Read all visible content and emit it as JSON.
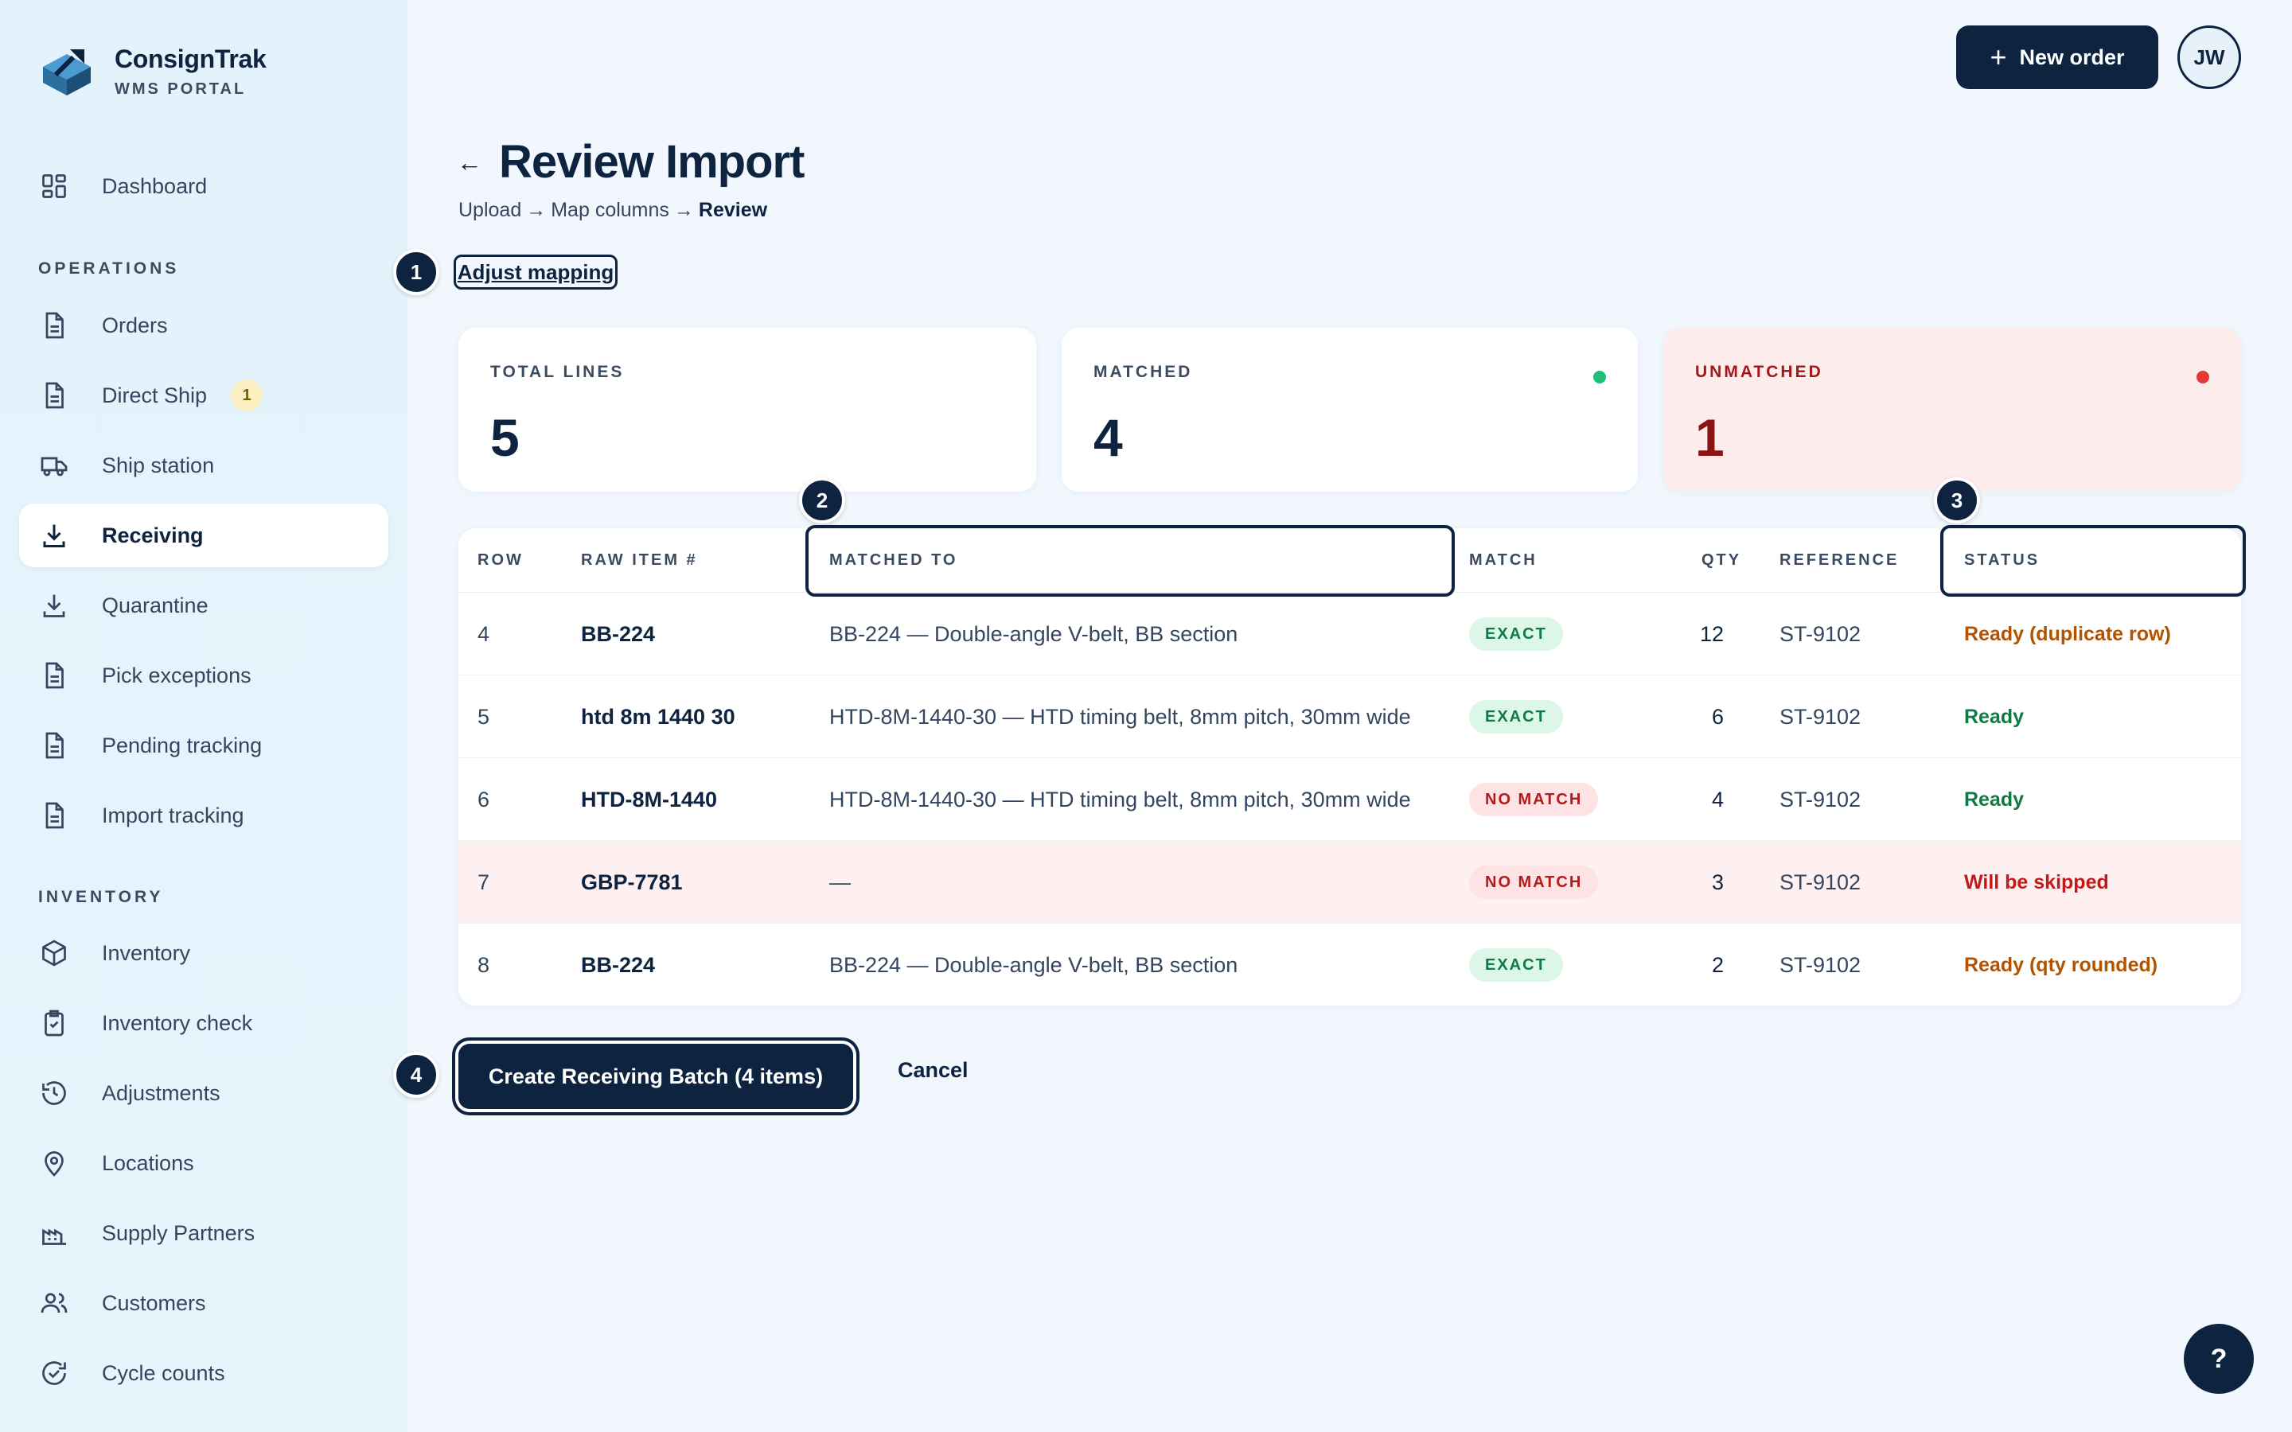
{
  "brand": {
    "name": "ConsignTrak",
    "subtitle": "WMS PORTAL"
  },
  "sidebar": {
    "top": [
      {
        "label": "Dashboard",
        "icon": "grid-icon"
      }
    ],
    "operations_label": "OPERATIONS",
    "operations": [
      {
        "label": "Orders",
        "icon": "document-icon"
      },
      {
        "label": "Direct Ship",
        "icon": "document-icon",
        "badge": "1"
      },
      {
        "label": "Ship station",
        "icon": "truck-icon"
      },
      {
        "label": "Receiving",
        "icon": "download-icon",
        "active": true
      },
      {
        "label": "Quarantine",
        "icon": "download-icon"
      },
      {
        "label": "Pick exceptions",
        "icon": "document-icon"
      },
      {
        "label": "Pending tracking",
        "icon": "document-icon"
      },
      {
        "label": "Import tracking",
        "icon": "document-icon"
      }
    ],
    "inventory_label": "INVENTORY",
    "inventory": [
      {
        "label": "Inventory",
        "icon": "box-icon"
      },
      {
        "label": "Inventory check",
        "icon": "clipboard-check-icon"
      },
      {
        "label": "Adjustments",
        "icon": "history-icon"
      },
      {
        "label": "Locations",
        "icon": "map-pin-icon"
      },
      {
        "label": "Supply Partners",
        "icon": "factory-icon"
      },
      {
        "label": "Customers",
        "icon": "users-icon"
      },
      {
        "label": "Cycle counts",
        "icon": "refresh-check-icon"
      }
    ]
  },
  "topbar": {
    "new_order": "New order",
    "avatar": "JW"
  },
  "header": {
    "title": "Review Import",
    "breadcrumb": {
      "step1": "Upload",
      "sep": "→",
      "step2": "Map columns",
      "step3": "Review"
    },
    "adjust_mapping": "Adjust mapping"
  },
  "steps": [
    "1",
    "2",
    "3",
    "4"
  ],
  "stats": {
    "total": {
      "label": "TOTAL LINES",
      "value": "5"
    },
    "matched": {
      "label": "MATCHED",
      "value": "4",
      "color": "#1fbf75"
    },
    "unmatched": {
      "label": "UNMATCHED",
      "value": "1",
      "color": "#e53935"
    }
  },
  "table": {
    "headers": {
      "row": "ROW",
      "raw": "RAW ITEM #",
      "matched": "MATCHED TO",
      "match": "MATCH",
      "qty": "QTY",
      "reference": "REFERENCE",
      "status": "STATUS"
    },
    "rows": [
      {
        "row": "4",
        "raw": "BB-224",
        "matched": "BB-224 — Double-angle V-belt, BB section",
        "match": "EXACT",
        "match_kind": "exact",
        "qty": "12",
        "reference": "ST-9102",
        "status": "Ready (duplicate row)",
        "status_kind": "warn"
      },
      {
        "row": "5",
        "raw": "htd 8m 1440 30",
        "matched": "HTD-8M-1440-30 — HTD timing belt, 8mm pitch, 30mm wide",
        "match": "EXACT",
        "match_kind": "exact",
        "qty": "6",
        "reference": "ST-9102",
        "status": "Ready",
        "status_kind": "ok"
      },
      {
        "row": "6",
        "raw": "HTD-8M-1440",
        "matched": "HTD-8M-1440-30 — HTD timing belt, 8mm pitch, 30mm wide",
        "match": "NO MATCH",
        "match_kind": "nomatch",
        "qty": "4",
        "reference": "ST-9102",
        "status": "Ready",
        "status_kind": "ok"
      },
      {
        "row": "7",
        "raw": "GBP-7781",
        "matched": "—",
        "match": "NO MATCH",
        "match_kind": "nomatch",
        "qty": "3",
        "reference": "ST-9102",
        "status": "Will be skipped",
        "status_kind": "bad"
      },
      {
        "row": "8",
        "raw": "BB-224",
        "matched": "BB-224 — Double-angle V-belt, BB section",
        "match": "EXACT",
        "match_kind": "exact",
        "qty": "2",
        "reference": "ST-9102",
        "status": "Ready (qty rounded)",
        "status_kind": "warn"
      }
    ]
  },
  "actions": {
    "create": "Create Receiving Batch (4 items)",
    "cancel": "Cancel"
  },
  "help": "?"
}
